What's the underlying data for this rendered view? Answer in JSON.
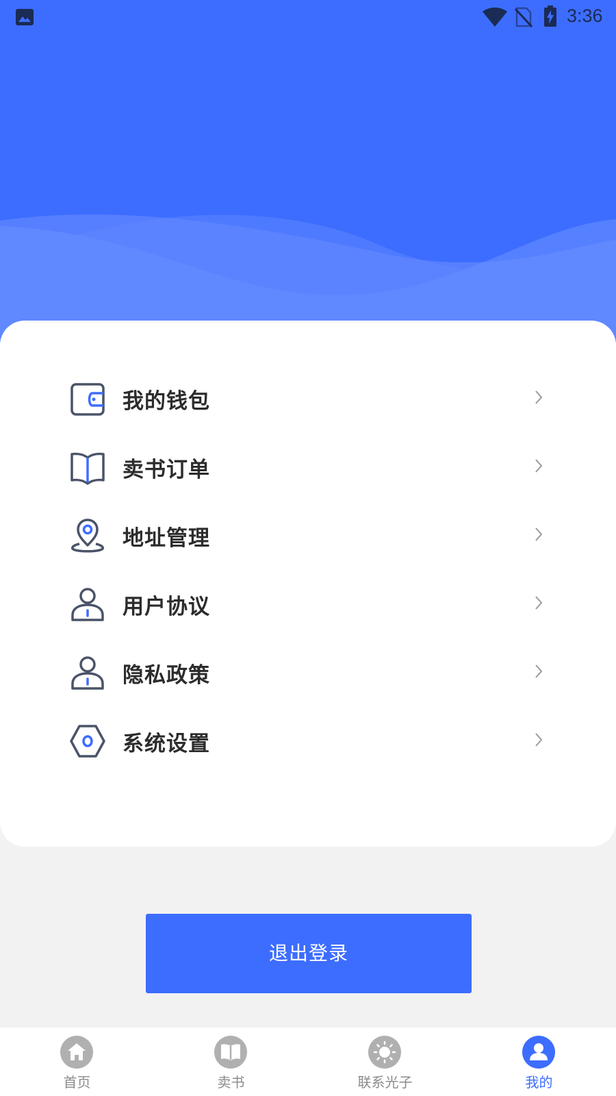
{
  "status_bar": {
    "time": "3:36",
    "icons": [
      "gallery-icon",
      "wifi-icon",
      "no-sim-icon",
      "battery-charging-icon"
    ]
  },
  "menu": {
    "items": [
      {
        "label": "我的钱包",
        "icon": "wallet-icon"
      },
      {
        "label": "卖书订单",
        "icon": "book-icon"
      },
      {
        "label": "地址管理",
        "icon": "location-pin-icon"
      },
      {
        "label": "用户协议",
        "icon": "user-icon"
      },
      {
        "label": "隐私政策",
        "icon": "user-icon"
      },
      {
        "label": "系统设置",
        "icon": "settings-icon"
      }
    ]
  },
  "logout": {
    "label": "退出登录"
  },
  "bottom_nav": {
    "items": [
      {
        "label": "首页",
        "icon": "home-icon",
        "active": false
      },
      {
        "label": "卖书",
        "icon": "book-icon",
        "active": false
      },
      {
        "label": "联系光子",
        "icon": "sun-icon",
        "active": false
      },
      {
        "label": "我的",
        "icon": "profile-icon",
        "active": true
      }
    ]
  },
  "colors": {
    "primary": "#3d6dff",
    "icon_stroke": "#4a5468",
    "text_dark": "#2c2c2c",
    "nav_inactive": "#b0b0b0",
    "page_bg": "#f2f2f3"
  }
}
